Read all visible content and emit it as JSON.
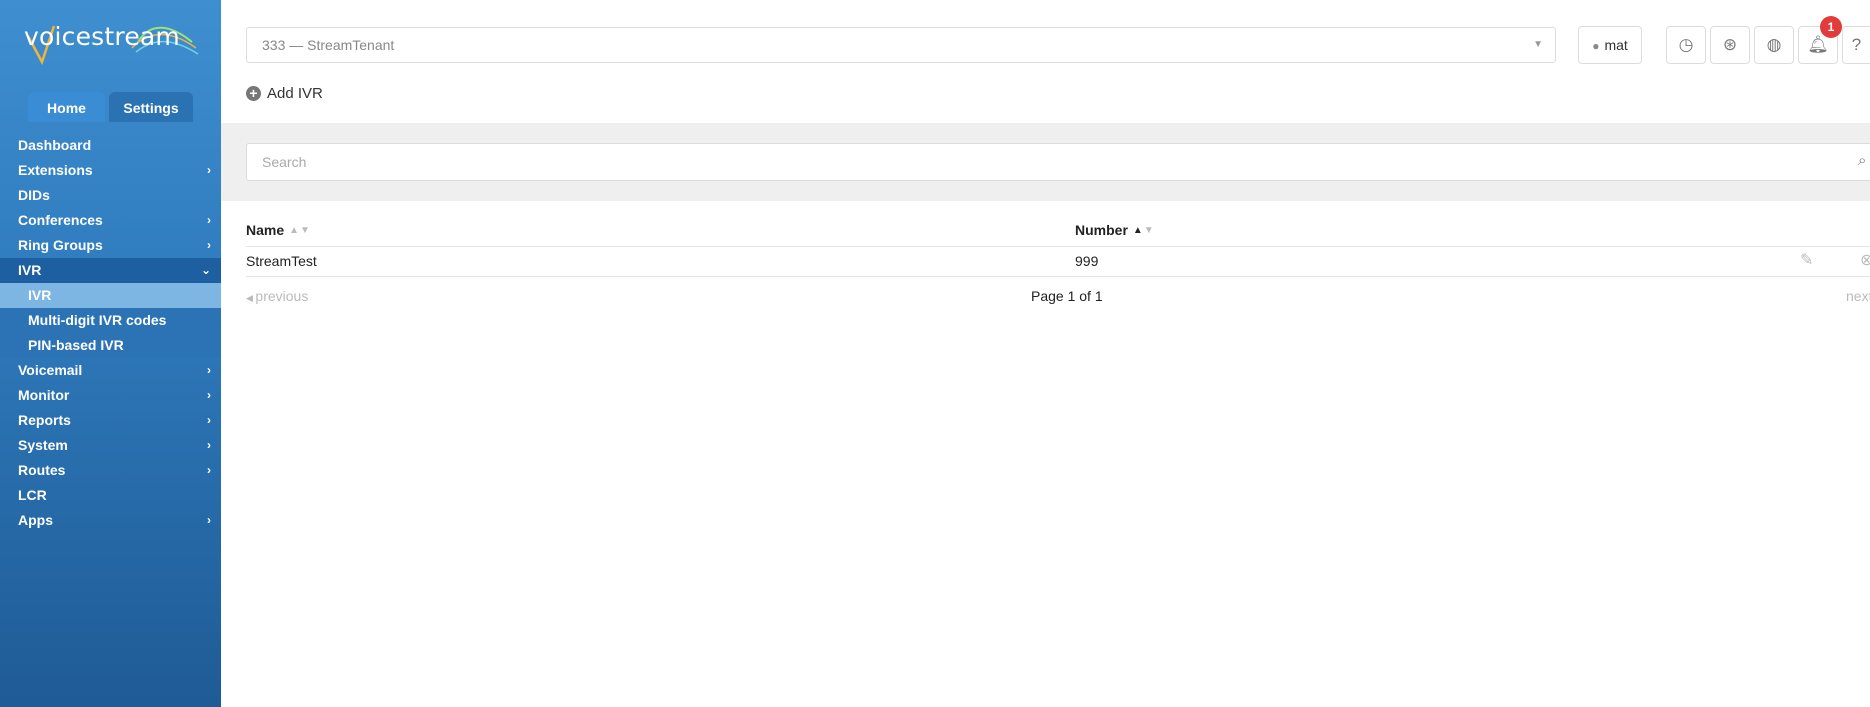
{
  "brand": {
    "logo_text": "voicestream",
    "accent": "#3a8dd4",
    "sidebar_dark": "#1f5b96"
  },
  "sidebar": {
    "tabs": [
      {
        "label": "Home"
      },
      {
        "label": "Settings"
      }
    ],
    "items": [
      {
        "label": "Dashboard",
        "chevron": ""
      },
      {
        "label": "Extensions",
        "chevron": "›"
      },
      {
        "label": "DIDs",
        "chevron": ""
      },
      {
        "label": "Conferences",
        "chevron": "›"
      },
      {
        "label": "Ring Groups",
        "chevron": "›"
      },
      {
        "label": "IVR",
        "chevron": "⌄"
      },
      {
        "label": "Voicemail",
        "chevron": "›"
      },
      {
        "label": "Monitor",
        "chevron": "›"
      },
      {
        "label": "Reports",
        "chevron": "›"
      },
      {
        "label": "System",
        "chevron": "›"
      },
      {
        "label": "Routes",
        "chevron": "›"
      },
      {
        "label": "LCR",
        "chevron": ""
      },
      {
        "label": "Apps",
        "chevron": "›"
      }
    ],
    "sub_items": [
      {
        "label": "IVR"
      },
      {
        "label": "Multi-digit IVR codes"
      },
      {
        "label": "PIN-based IVR"
      }
    ]
  },
  "header": {
    "tenant_value": "333  —  StreamTenant",
    "user_label": "mat",
    "notification_count": "1",
    "icons": [
      "clock-icon",
      "lifebuoy-icon",
      "globe-icon",
      "bell-icon",
      "help-icon"
    ]
  },
  "toolbar": {
    "add_label": "Add IVR"
  },
  "search": {
    "placeholder": "Search"
  },
  "table": {
    "columns": [
      {
        "label": "Name"
      },
      {
        "label": "Number"
      }
    ],
    "rows": [
      {
        "name": "StreamTest",
        "number": "999"
      }
    ]
  },
  "pager": {
    "prev": "previous",
    "page": "Page 1 of 1",
    "next": "next"
  }
}
